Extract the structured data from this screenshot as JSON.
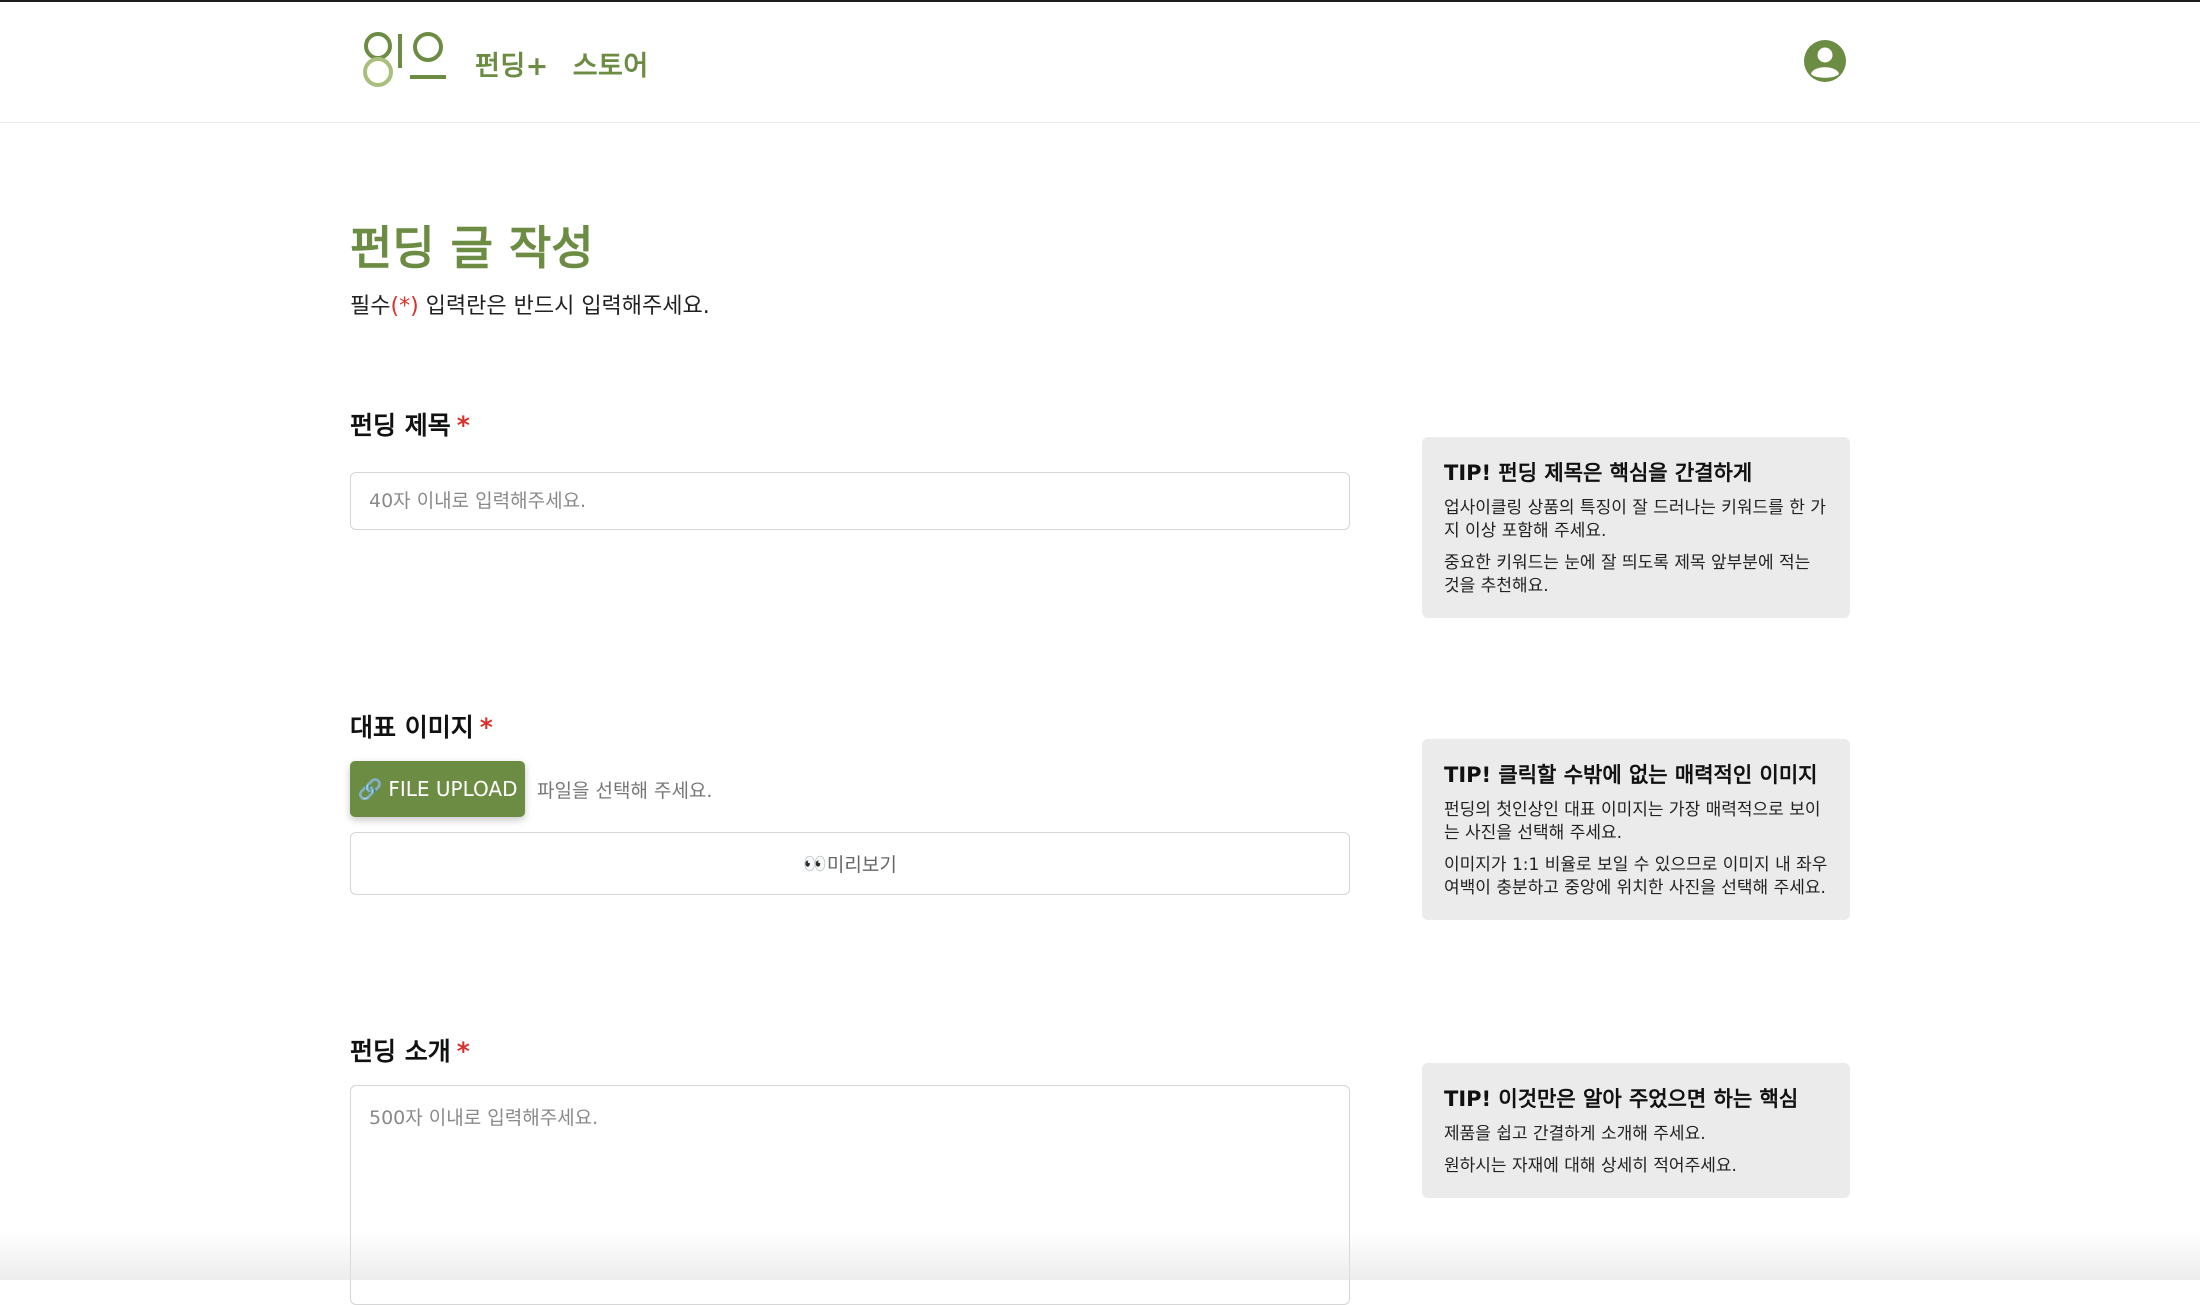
{
  "header": {
    "logo_alt": "위으",
    "nav": [
      "펀딩+",
      "스토어"
    ],
    "colors": {
      "brand": "#6b8c42"
    },
    "profile_icon": "user-circle-icon"
  },
  "page": {
    "title": "펀딩 글 작성",
    "subtitle_pre": "필수",
    "subtitle_req": "(*)",
    "subtitle_post": " 입력란은 반드시 입력해주세요."
  },
  "fields": {
    "title": {
      "label": "펀딩 제목",
      "required_mark": "*",
      "placeholder": "40자 이내로 입력해주세요.",
      "value": ""
    },
    "image": {
      "label": "대표 이미지",
      "required_mark": "*",
      "upload_icon": "🔗",
      "upload_label": "FILE UPLOAD",
      "file_hint": "파일을 선택해 주세요.",
      "preview_icon": "👀",
      "preview_label": "미리보기"
    },
    "intro": {
      "label": "펀딩 소개",
      "required_mark": "*",
      "placeholder": "500자 이내로 입력해주세요.",
      "value": ""
    }
  },
  "tips": [
    {
      "title": "TIP! 펀딩 제목은 핵심을 간결하게",
      "lines": [
        "업사이클링 상품의 특징이 잘 드러나는 키워드를 한 가지 이상 포함해 주세요.",
        "중요한 키워드는 눈에 잘 띄도록 제목 앞부분에 적는 것을 추천해요."
      ]
    },
    {
      "title": "TIP! 클릭할 수밖에 없는 매력적인 이미지",
      "lines": [
        "펀딩의 첫인상인 대표 이미지는 가장 매력적으로 보이는 사진을 선택해 주세요.",
        "이미지가 1:1 비율로 보일 수 있으므로 이미지 내 좌우 여백이 충분하고 중앙에 위치한 사진을 선택해 주세요."
      ]
    },
    {
      "title": "TIP! 이것만은 알아 주었으면 하는 핵심",
      "lines": [
        "제품을 쉽고 간결하게 소개해 주세요.",
        "원하시는 자재에 대해 상세히 적어주세요."
      ]
    }
  ]
}
